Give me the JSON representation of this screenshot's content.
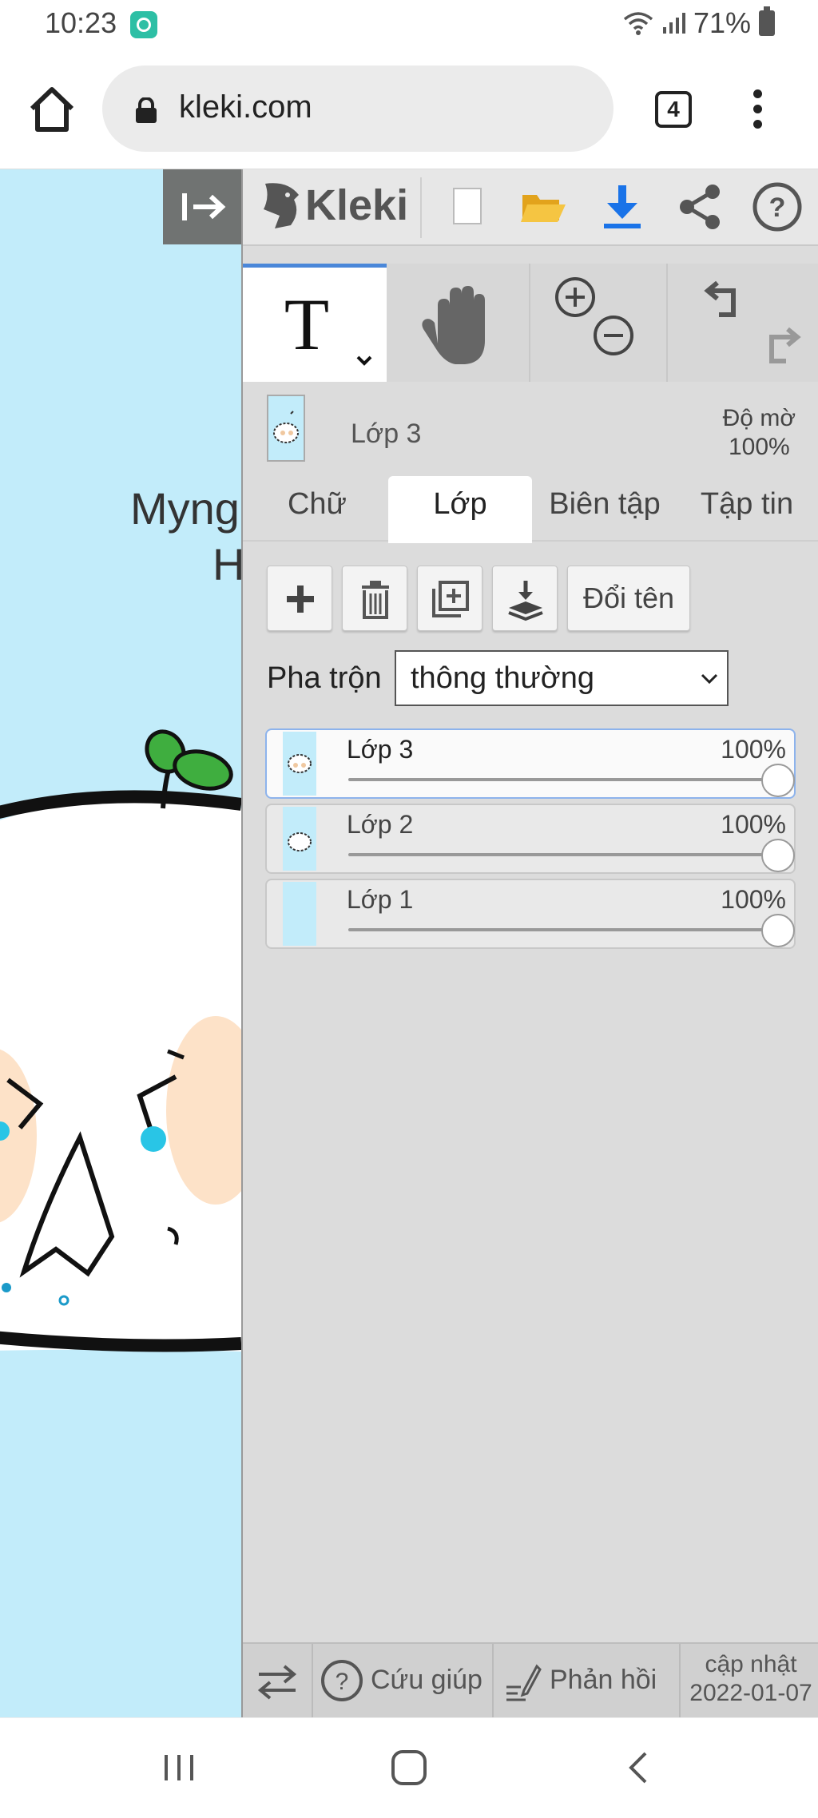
{
  "status": {
    "time": "10:23",
    "battery": "71%"
  },
  "browser": {
    "url": "kleki.com",
    "tab_count": "4"
  },
  "canvas": {
    "text_line1": "Myng",
    "text_line2": "H"
  },
  "app": {
    "logo": "Kleki"
  },
  "layer_info": {
    "current_layer": "Lớp 3",
    "opacity_label": "Độ mờ",
    "opacity_value": "100%"
  },
  "tabs": [
    {
      "label": "Chữ"
    },
    {
      "label": "Lớp"
    },
    {
      "label": "Biên tập"
    },
    {
      "label": "Tập tin"
    }
  ],
  "active_tab": "Lớp",
  "layer_actions": {
    "rename": "Đổi tên"
  },
  "blend": {
    "label": "Pha trộn",
    "value": "thông thường"
  },
  "layers": [
    {
      "name": "Lớp 3",
      "opacity": "100%",
      "opacity_fraction": 1.0,
      "selected": true
    },
    {
      "name": "Lớp 2",
      "opacity": "100%",
      "opacity_fraction": 1.0,
      "selected": false
    },
    {
      "name": "Lớp 1",
      "opacity": "100%",
      "opacity_fraction": 1.0,
      "selected": false
    }
  ],
  "footer": {
    "help": "Cứu giúp",
    "feedback": "Phản hồi",
    "update_label": "cập nhật",
    "update_date": "2022-01-07"
  },
  "colors": {
    "canvas_bg": "#c2ecfa",
    "panel_bg": "#dcdcdc",
    "accent": "#4a87d9",
    "folder": "#f5c542",
    "download": "#1a73e8"
  }
}
